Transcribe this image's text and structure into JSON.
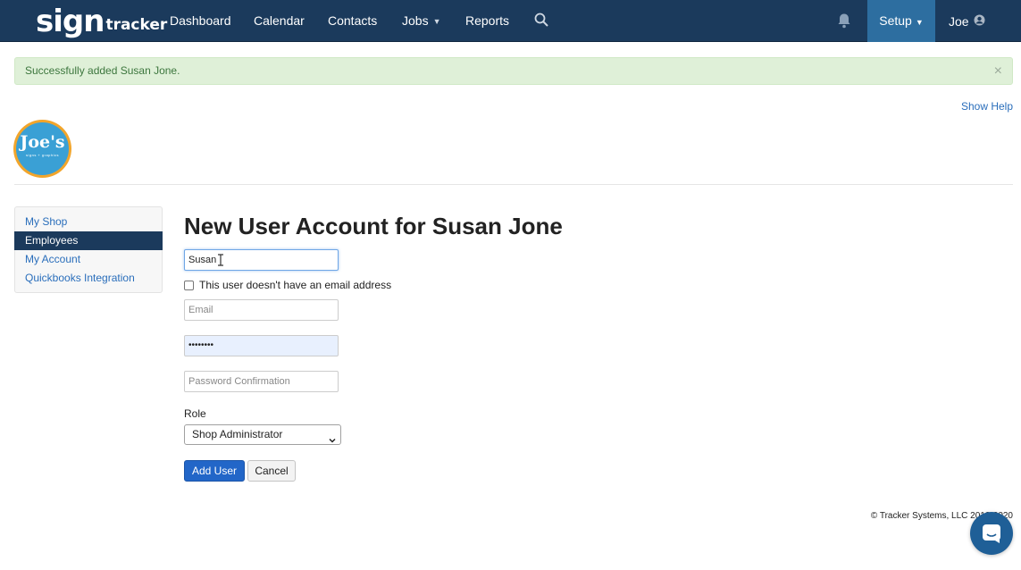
{
  "navbar": {
    "brand_sign": "sign",
    "brand_tracker": "tracker",
    "items": [
      {
        "label": "Dashboard"
      },
      {
        "label": "Calendar"
      },
      {
        "label": "Contacts"
      },
      {
        "label": "Jobs"
      },
      {
        "label": "Reports"
      }
    ],
    "setup_label": "Setup",
    "user_label": "Joe",
    "icons": {
      "search": "search-icon",
      "notifications": "bell-icon",
      "user": "user-circle-icon",
      "dropdown": "caret-down-icon"
    }
  },
  "alert": {
    "message": "Successfully added Susan Jone.",
    "close": "×"
  },
  "show_help": "Show Help",
  "logo": {
    "text": "Joe's",
    "subtext": "signs + graphics"
  },
  "sidebar": {
    "items": [
      {
        "label": "My Shop"
      },
      {
        "label": "Employees"
      },
      {
        "label": "My Account"
      },
      {
        "label": "Quickbooks Integration"
      }
    ]
  },
  "form": {
    "title": "New User Account for Susan Jone",
    "name_value": "Susan",
    "no_email_label": "This user doesn't have an email address",
    "email_placeholder": "Email",
    "password_value": "••••••••",
    "password_confirm_placeholder": "Password Confirmation",
    "role_label": "Role",
    "role_value": "Shop Administrator",
    "submit_label": "Add User",
    "cancel_label": "Cancel"
  },
  "footer": {
    "copyright": "© Tracker Systems, LLC 2012-2020"
  },
  "colors": {
    "navbar": "#1b3a5c",
    "setup_active": "#2d6ea0",
    "link": "#2a6ebb",
    "alert_bg": "#dff0d8",
    "primary_button": "#2266c8",
    "chat_bubble": "#1f5f97"
  }
}
